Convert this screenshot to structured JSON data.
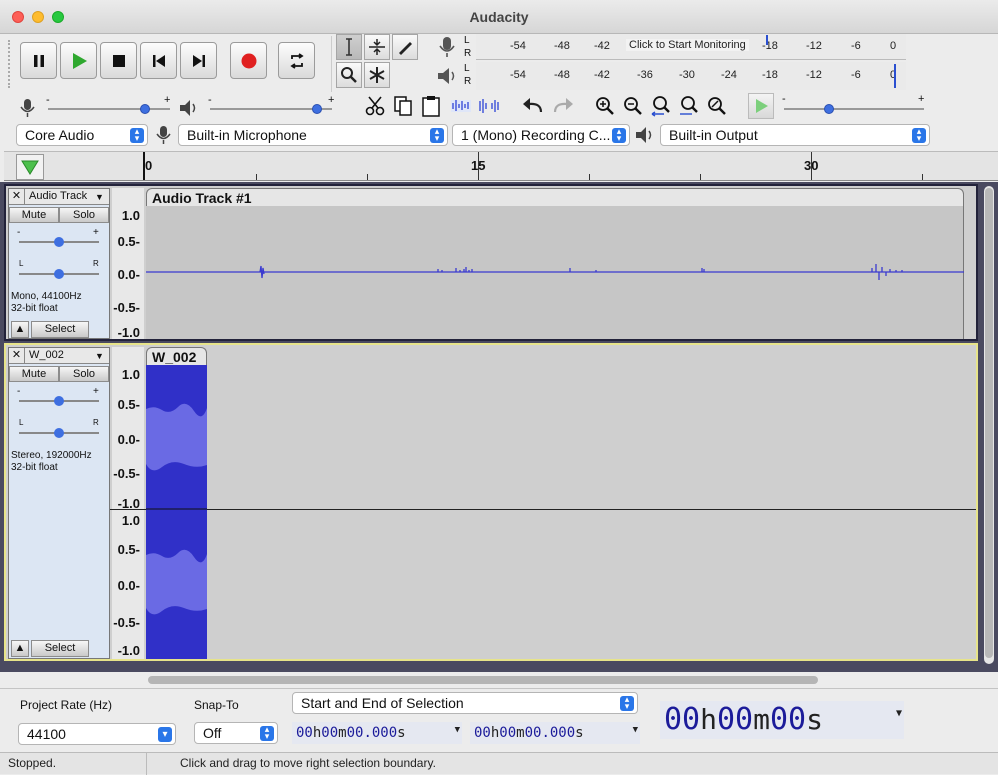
{
  "window": {
    "title": "Audacity"
  },
  "transport": {
    "pause": "pause-icon",
    "play": "play-icon",
    "stop": "stop-icon",
    "skip_start": "skip-start-icon",
    "skip_end": "skip-end-icon",
    "record": "record-icon",
    "loop": "loop-icon",
    "colors": {
      "play": "#2fa82f",
      "record": "#e02020"
    }
  },
  "meters": {
    "record_ticks": [
      "-54",
      "-48",
      "-42",
      "-18",
      "-12",
      "-6",
      "0"
    ],
    "monitor_prompt": "Click to Start Monitoring",
    "play_ticks": [
      "-54",
      "-48",
      "-42",
      "-36",
      "-30",
      "-24",
      "-18",
      "-12",
      "-6",
      "0"
    ],
    "channel_l": "L",
    "channel_r": "R"
  },
  "mixer": {
    "minus": "-",
    "plus": "+"
  },
  "devices": {
    "host": "Core Audio",
    "input": "Built-in Microphone",
    "channels": "1 (Mono) Recording C...",
    "output": "Built-in Output"
  },
  "ruler": {
    "labels": [
      "0",
      "15",
      "30"
    ]
  },
  "tracks": [
    {
      "name": "Audio Track",
      "clip": "Audio Track #1",
      "mute": "Mute",
      "solo": "Solo",
      "info1": "Mono, 44100Hz",
      "info2": "32-bit float",
      "select": "Select",
      "scale": [
        "1.0",
        "0.5-",
        "0.0-",
        "-0.5-",
        "-1.0"
      ],
      "pan_l": "L",
      "pan_r": "R",
      "gain_minus": "-",
      "gain_plus": "+"
    },
    {
      "name": "W_002",
      "clip": "W_002",
      "mute": "Mute",
      "solo": "Solo",
      "info1": "Stereo, 192000Hz",
      "info2": "32-bit float",
      "select": "Select",
      "scale": [
        "1.0",
        "0.5-",
        "0.0-",
        "-0.5-",
        "-1.0"
      ],
      "scale2": [
        "1.0",
        "0.5-",
        "0.0-",
        "-0.5-",
        "-1.0"
      ],
      "pan_l": "L",
      "pan_r": "R",
      "gain_minus": "-",
      "gain_plus": "+"
    }
  ],
  "selection_bar": {
    "rate_label": "Project Rate (Hz)",
    "rate_value": "44100",
    "snap_label": "Snap-To",
    "snap_value": "Off",
    "mode": "Start and End of Selection",
    "start": {
      "h": "00",
      "m": "00",
      "s": "00.000"
    },
    "end": {
      "h": "00",
      "m": "00",
      "s": "00.000"
    },
    "time_h": "00",
    "time_m": "00",
    "time_s": "00",
    "unit_h": "h",
    "unit_m": "m",
    "unit_s": "s"
  },
  "status": {
    "left": "Stopped.",
    "right": "Click and drag to move right selection boundary."
  }
}
